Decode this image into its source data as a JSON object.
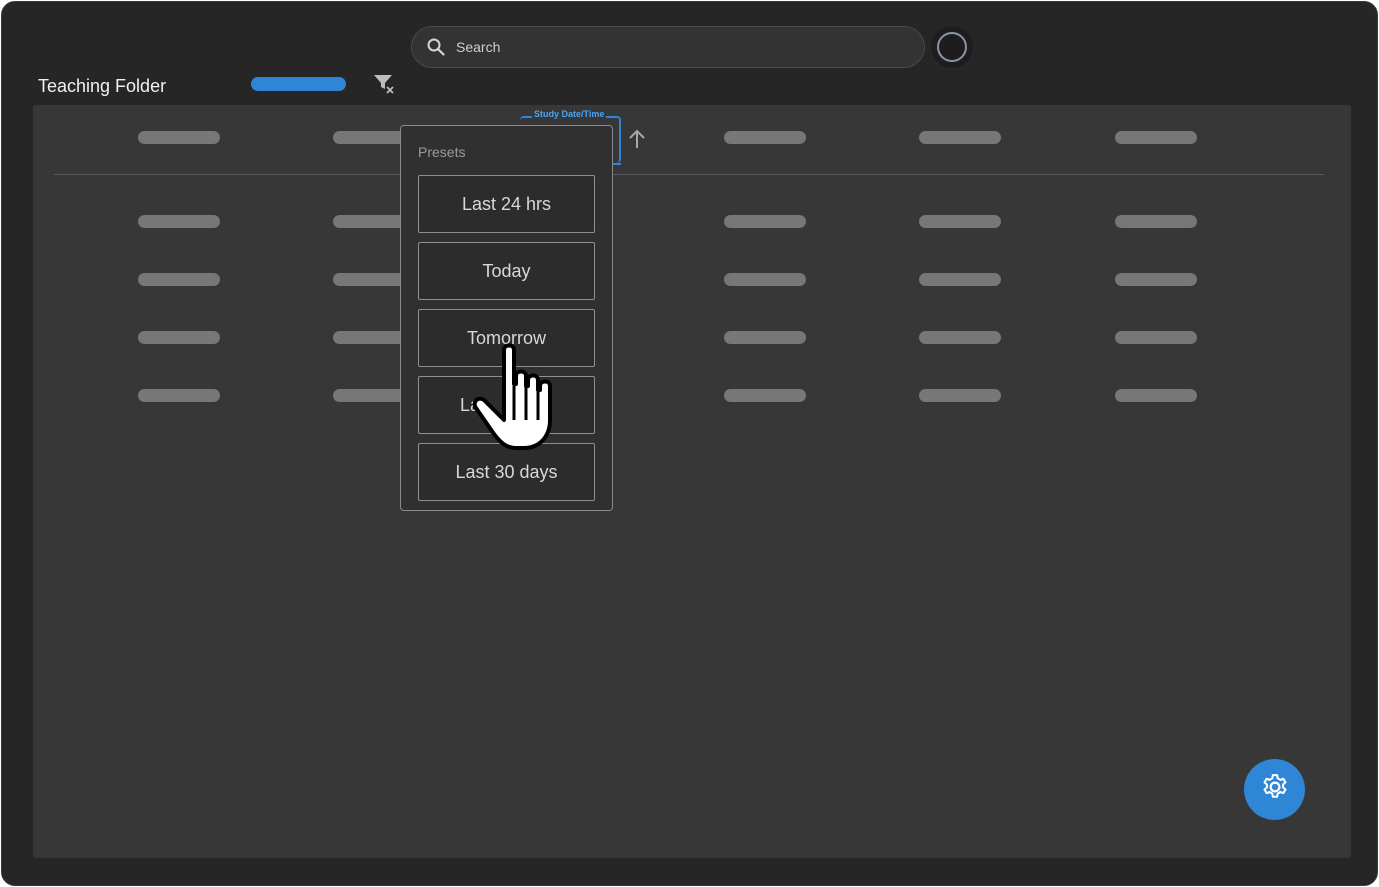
{
  "header": {
    "folder_title": "Teaching Folder",
    "search_placeholder": "Search"
  },
  "table": {
    "sorted_column_label": "Study Date/Time",
    "sort_direction": "ascending"
  },
  "presets_menu": {
    "heading": "Presets",
    "options": [
      "Last 24 hrs",
      "Today",
      "Tomorrow",
      "La",
      "Last 30 days"
    ]
  },
  "colors": {
    "accent": "#2f86d6",
    "background": "#262626",
    "panel": "#373737",
    "skeleton": "#777777"
  },
  "icons": {
    "search": "search-icon",
    "filter_clear": "filter-clear-icon",
    "sort": "arrow-up-icon",
    "settings": "gear-icon",
    "cursor": "hand-pointer-icon",
    "avatar": "avatar-icon"
  }
}
